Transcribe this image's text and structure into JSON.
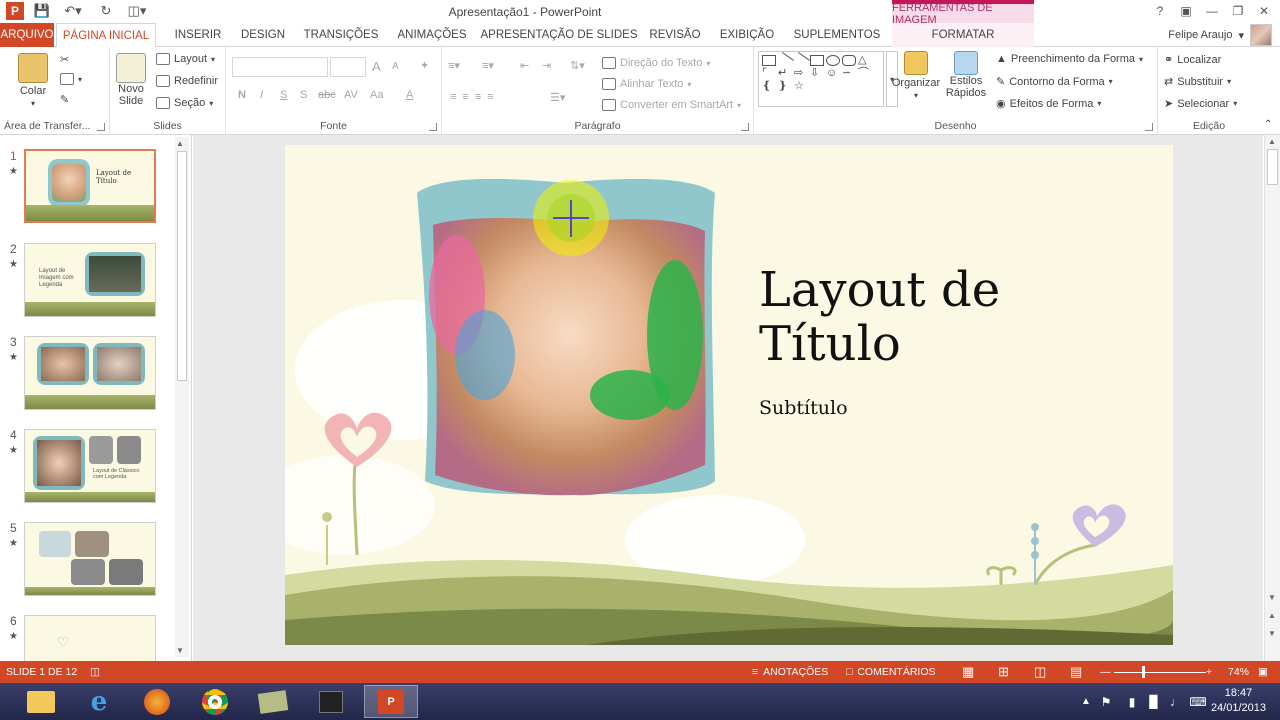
{
  "window": {
    "title": "Apresentação1 - PowerPoint",
    "context_title": "FERRAMENTAS DE IMAGEM"
  },
  "tabs": [
    {
      "label": "ARQUIVO"
    },
    {
      "label": "PÁGINA INICIAL"
    },
    {
      "label": "INSERIR"
    },
    {
      "label": "DESIGN"
    },
    {
      "label": "TRANSIÇÕES"
    },
    {
      "label": "ANIMAÇÕES"
    },
    {
      "label": "APRESENTAÇÃO DE SLIDES"
    },
    {
      "label": "REVISÃO"
    },
    {
      "label": "EXIBIÇÃO"
    },
    {
      "label": "SUPLEMENTOS"
    },
    {
      "label": "FORMATAR"
    }
  ],
  "user": {
    "name": "Felipe Araujo"
  },
  "ribbon": {
    "clipboard": {
      "label": "Área de Transfer...",
      "paste": "Colar"
    },
    "slides": {
      "label": "Slides",
      "new_slide_1": "Novo",
      "new_slide_2": "Slide",
      "layout": "Layout",
      "reset": "Redefinir",
      "section": "Seção"
    },
    "font": {
      "label": "Fonte",
      "bold": "N",
      "italic": "I",
      "underline": "S",
      "shadow": "S",
      "strike": "abc",
      "spacing": "AV",
      "case": "Aa",
      "grow": "A",
      "shrink": "A"
    },
    "paragraph": {
      "label": "Parágrafo",
      "text_direction": "Direção do Texto",
      "align_text": "Alinhar Texto",
      "convert_smartart": "Converter em SmartArt"
    },
    "drawing": {
      "label": "Desenho",
      "arrange": "Organizar",
      "quick_styles_1": "Estilos",
      "quick_styles_2": "Rápidos",
      "shape_fill": "Preenchimento da Forma",
      "shape_outline": "Contorno da Forma",
      "shape_effects": "Efeitos de Forma"
    },
    "editing": {
      "label": "Edição",
      "find": "Localizar",
      "replace": "Substituir",
      "select": "Selecionar"
    }
  },
  "thumbnails": [
    {
      "num": "1",
      "star": "★",
      "text": "Layout de Título"
    },
    {
      "num": "2",
      "star": "★",
      "text": "Layout de Imagem com Legenda"
    },
    {
      "num": "3",
      "star": "★",
      "text": ""
    },
    {
      "num": "4",
      "star": "★",
      "text": "Layout de Clássico com Legenda"
    },
    {
      "num": "5",
      "star": "★",
      "text": ""
    },
    {
      "num": "6",
      "star": "★",
      "text": ""
    }
  ],
  "slide": {
    "title": "Layout de Título",
    "subtitle": "Subtítulo"
  },
  "status": {
    "slide_info": "SLIDE 1 DE 12",
    "notes": "ANOTAÇÕES",
    "comments": "COMENTÁRIOS",
    "zoom": "74%"
  },
  "taskbar": {
    "time": "18:47",
    "date": "24/01/2013"
  },
  "colors": {
    "accent": "#d24726",
    "context": "#c2185b"
  }
}
